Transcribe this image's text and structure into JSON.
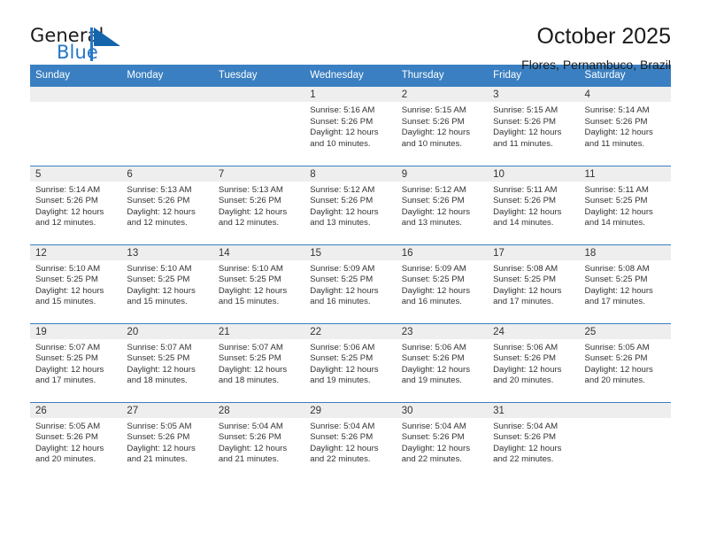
{
  "logo": {
    "text_top": "General",
    "text_bottom": "Blue",
    "triangle_color": "#1565ad",
    "blue_color": "#2478c8"
  },
  "header": {
    "title": "October 2025",
    "subtitle": "Flores, Pernambuco, Brazil"
  },
  "theme": {
    "header_bg": "#3a7fc1",
    "daynum_bg": "#eeeeee",
    "text": "#333333"
  },
  "weekday_headers": [
    "Sunday",
    "Monday",
    "Tuesday",
    "Wednesday",
    "Thursday",
    "Friday",
    "Saturday"
  ],
  "labels": {
    "sunrise_prefix": "Sunrise:",
    "sunset_prefix": "Sunset:",
    "daylight_prefix": "Daylight:"
  },
  "weeks": [
    [
      {
        "day": "",
        "empty": true
      },
      {
        "day": "",
        "empty": true
      },
      {
        "day": "",
        "empty": true
      },
      {
        "day": "1",
        "sunrise": "Sunrise: 5:16 AM",
        "sunset": "Sunset: 5:26 PM",
        "daylight1": "Daylight: 12 hours",
        "daylight2": "and 10 minutes."
      },
      {
        "day": "2",
        "sunrise": "Sunrise: 5:15 AM",
        "sunset": "Sunset: 5:26 PM",
        "daylight1": "Daylight: 12 hours",
        "daylight2": "and 10 minutes."
      },
      {
        "day": "3",
        "sunrise": "Sunrise: 5:15 AM",
        "sunset": "Sunset: 5:26 PM",
        "daylight1": "Daylight: 12 hours",
        "daylight2": "and 11 minutes."
      },
      {
        "day": "4",
        "sunrise": "Sunrise: 5:14 AM",
        "sunset": "Sunset: 5:26 PM",
        "daylight1": "Daylight: 12 hours",
        "daylight2": "and 11 minutes."
      }
    ],
    [
      {
        "day": "5",
        "sunrise": "Sunrise: 5:14 AM",
        "sunset": "Sunset: 5:26 PM",
        "daylight1": "Daylight: 12 hours",
        "daylight2": "and 12 minutes."
      },
      {
        "day": "6",
        "sunrise": "Sunrise: 5:13 AM",
        "sunset": "Sunset: 5:26 PM",
        "daylight1": "Daylight: 12 hours",
        "daylight2": "and 12 minutes."
      },
      {
        "day": "7",
        "sunrise": "Sunrise: 5:13 AM",
        "sunset": "Sunset: 5:26 PM",
        "daylight1": "Daylight: 12 hours",
        "daylight2": "and 12 minutes."
      },
      {
        "day": "8",
        "sunrise": "Sunrise: 5:12 AM",
        "sunset": "Sunset: 5:26 PM",
        "daylight1": "Daylight: 12 hours",
        "daylight2": "and 13 minutes."
      },
      {
        "day": "9",
        "sunrise": "Sunrise: 5:12 AM",
        "sunset": "Sunset: 5:26 PM",
        "daylight1": "Daylight: 12 hours",
        "daylight2": "and 13 minutes."
      },
      {
        "day": "10",
        "sunrise": "Sunrise: 5:11 AM",
        "sunset": "Sunset: 5:26 PM",
        "daylight1": "Daylight: 12 hours",
        "daylight2": "and 14 minutes."
      },
      {
        "day": "11",
        "sunrise": "Sunrise: 5:11 AM",
        "sunset": "Sunset: 5:25 PM",
        "daylight1": "Daylight: 12 hours",
        "daylight2": "and 14 minutes."
      }
    ],
    [
      {
        "day": "12",
        "sunrise": "Sunrise: 5:10 AM",
        "sunset": "Sunset: 5:25 PM",
        "daylight1": "Daylight: 12 hours",
        "daylight2": "and 15 minutes."
      },
      {
        "day": "13",
        "sunrise": "Sunrise: 5:10 AM",
        "sunset": "Sunset: 5:25 PM",
        "daylight1": "Daylight: 12 hours",
        "daylight2": "and 15 minutes."
      },
      {
        "day": "14",
        "sunrise": "Sunrise: 5:10 AM",
        "sunset": "Sunset: 5:25 PM",
        "daylight1": "Daylight: 12 hours",
        "daylight2": "and 15 minutes."
      },
      {
        "day": "15",
        "sunrise": "Sunrise: 5:09 AM",
        "sunset": "Sunset: 5:25 PM",
        "daylight1": "Daylight: 12 hours",
        "daylight2": "and 16 minutes."
      },
      {
        "day": "16",
        "sunrise": "Sunrise: 5:09 AM",
        "sunset": "Sunset: 5:25 PM",
        "daylight1": "Daylight: 12 hours",
        "daylight2": "and 16 minutes."
      },
      {
        "day": "17",
        "sunrise": "Sunrise: 5:08 AM",
        "sunset": "Sunset: 5:25 PM",
        "daylight1": "Daylight: 12 hours",
        "daylight2": "and 17 minutes."
      },
      {
        "day": "18",
        "sunrise": "Sunrise: 5:08 AM",
        "sunset": "Sunset: 5:25 PM",
        "daylight1": "Daylight: 12 hours",
        "daylight2": "and 17 minutes."
      }
    ],
    [
      {
        "day": "19",
        "sunrise": "Sunrise: 5:07 AM",
        "sunset": "Sunset: 5:25 PM",
        "daylight1": "Daylight: 12 hours",
        "daylight2": "and 17 minutes."
      },
      {
        "day": "20",
        "sunrise": "Sunrise: 5:07 AM",
        "sunset": "Sunset: 5:25 PM",
        "daylight1": "Daylight: 12 hours",
        "daylight2": "and 18 minutes."
      },
      {
        "day": "21",
        "sunrise": "Sunrise: 5:07 AM",
        "sunset": "Sunset: 5:25 PM",
        "daylight1": "Daylight: 12 hours",
        "daylight2": "and 18 minutes."
      },
      {
        "day": "22",
        "sunrise": "Sunrise: 5:06 AM",
        "sunset": "Sunset: 5:25 PM",
        "daylight1": "Daylight: 12 hours",
        "daylight2": "and 19 minutes."
      },
      {
        "day": "23",
        "sunrise": "Sunrise: 5:06 AM",
        "sunset": "Sunset: 5:26 PM",
        "daylight1": "Daylight: 12 hours",
        "daylight2": "and 19 minutes."
      },
      {
        "day": "24",
        "sunrise": "Sunrise: 5:06 AM",
        "sunset": "Sunset: 5:26 PM",
        "daylight1": "Daylight: 12 hours",
        "daylight2": "and 20 minutes."
      },
      {
        "day": "25",
        "sunrise": "Sunrise: 5:05 AM",
        "sunset": "Sunset: 5:26 PM",
        "daylight1": "Daylight: 12 hours",
        "daylight2": "and 20 minutes."
      }
    ],
    [
      {
        "day": "26",
        "sunrise": "Sunrise: 5:05 AM",
        "sunset": "Sunset: 5:26 PM",
        "daylight1": "Daylight: 12 hours",
        "daylight2": "and 20 minutes."
      },
      {
        "day": "27",
        "sunrise": "Sunrise: 5:05 AM",
        "sunset": "Sunset: 5:26 PM",
        "daylight1": "Daylight: 12 hours",
        "daylight2": "and 21 minutes."
      },
      {
        "day": "28",
        "sunrise": "Sunrise: 5:04 AM",
        "sunset": "Sunset: 5:26 PM",
        "daylight1": "Daylight: 12 hours",
        "daylight2": "and 21 minutes."
      },
      {
        "day": "29",
        "sunrise": "Sunrise: 5:04 AM",
        "sunset": "Sunset: 5:26 PM",
        "daylight1": "Daylight: 12 hours",
        "daylight2": "and 22 minutes."
      },
      {
        "day": "30",
        "sunrise": "Sunrise: 5:04 AM",
        "sunset": "Sunset: 5:26 PM",
        "daylight1": "Daylight: 12 hours",
        "daylight2": "and 22 minutes."
      },
      {
        "day": "31",
        "sunrise": "Sunrise: 5:04 AM",
        "sunset": "Sunset: 5:26 PM",
        "daylight1": "Daylight: 12 hours",
        "daylight2": "and 22 minutes."
      },
      {
        "day": "",
        "empty": true
      }
    ]
  ]
}
